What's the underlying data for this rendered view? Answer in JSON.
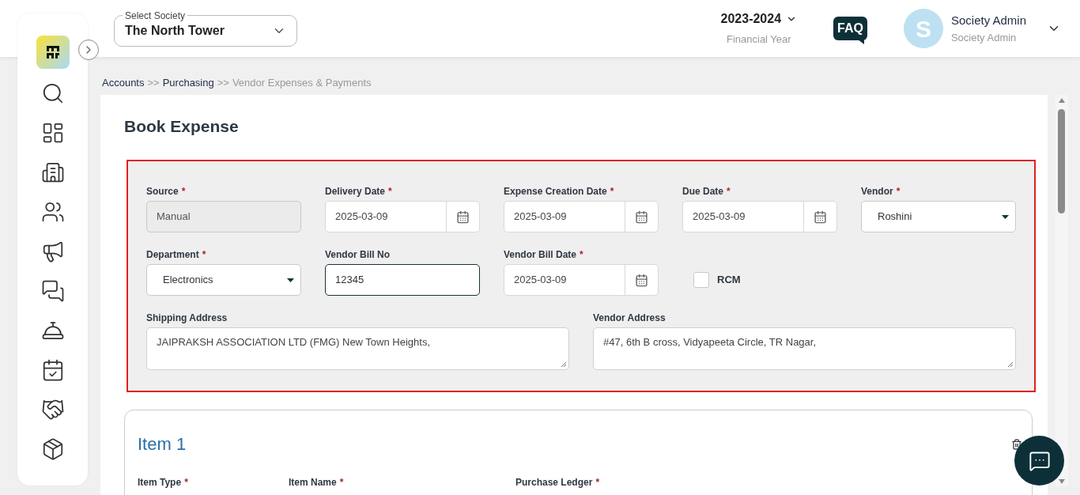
{
  "header": {
    "society_select": {
      "label": "Select Society",
      "value": "The North Tower"
    },
    "financial_year": {
      "value": "2023-2024",
      "label": "Financial Year"
    },
    "faq": "FAQ",
    "user": {
      "initial": "S",
      "name": "Society Admin",
      "role": "Society Admin"
    }
  },
  "breadcrumb": {
    "separator": ">>",
    "items": [
      {
        "label": "Accounts",
        "current": false
      },
      {
        "label": "Purchasing",
        "current": false
      },
      {
        "label": "Vendor Expenses & Payments",
        "current": true
      }
    ]
  },
  "title": "Book Expense",
  "form": {
    "rows": [
      {
        "fields": [
          {
            "kind": "readonly",
            "label": "Source",
            "required": true,
            "value": "Manual"
          },
          {
            "kind": "date",
            "label": "Delivery Date",
            "required": true,
            "value": "2025-03-09"
          },
          {
            "kind": "date",
            "label": "Expense Creation Date",
            "required": true,
            "value": "2025-03-09"
          },
          {
            "kind": "date",
            "label": "Due Date",
            "required": true,
            "value": "2025-03-09"
          },
          {
            "kind": "select",
            "label": "Vendor",
            "required": true,
            "value": "Roshini"
          }
        ]
      },
      {
        "fields": [
          {
            "kind": "select",
            "label": "Department",
            "required": true,
            "value": "Electronics"
          },
          {
            "kind": "text",
            "label": "Vendor Bill No",
            "required": false,
            "value": "12345",
            "focused": true
          },
          {
            "kind": "date",
            "label": "Vendor Bill Date",
            "required": true,
            "value": "2025-03-09"
          },
          {
            "kind": "checkbox",
            "label": "RCM",
            "checked": false
          }
        ]
      },
      {
        "fields": [
          {
            "kind": "textarea",
            "label": "Shipping Address",
            "required": false,
            "value": "JAIPRAKSH ASSOCIATION LTD (FMG) New Town Heights,"
          },
          {
            "kind": "textarea",
            "label": "Vendor Address",
            "required": false,
            "value": "#47, 6th B cross, Vidyapeeta Circle, TR Nagar,"
          }
        ]
      }
    ],
    "required_marker": "*"
  },
  "item": {
    "title": "Item 1",
    "columns": [
      {
        "label": "Item Type",
        "required": true
      },
      {
        "label": "Item Name",
        "required": true
      },
      {
        "label": "Purchase Ledger",
        "required": true
      }
    ]
  }
}
